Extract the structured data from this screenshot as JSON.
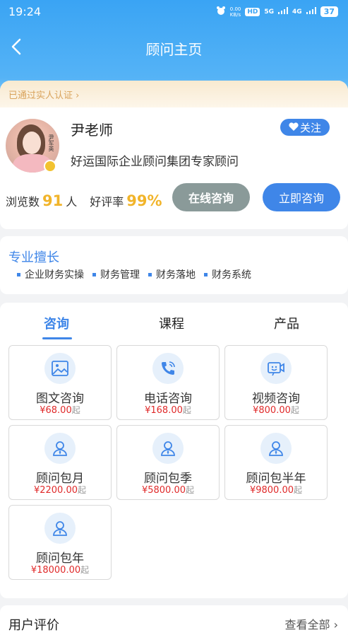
{
  "status_bar": {
    "time": "19:24",
    "net_speed": "0.00\nKB/s",
    "hd": "HD",
    "signal_5g": "5G",
    "signal_4g": "4G",
    "battery": "37"
  },
  "nav": {
    "title": "顾问主页"
  },
  "profile": {
    "verified_text": "已通过实人认证 ›",
    "name": "尹老师",
    "follow_label": "关注",
    "title": "好运国际企业顾问集团专家顾问",
    "views_label": "浏览数",
    "views_value": "91",
    "views_unit": "人",
    "rating_label": "好评率",
    "rating_value": "99%",
    "avatar_text": "尹军英",
    "btn_online": "在线咨询",
    "btn_now": "立即咨询"
  },
  "specialty": {
    "title": "专业擅长",
    "items": [
      "企业财务实操",
      "财务管理",
      "财务落地",
      "财务系统"
    ]
  },
  "tabs": [
    "咨询",
    "课程",
    "产品"
  ],
  "services": [
    {
      "label": "图文咨询",
      "price": "¥68.00",
      "suffix": "起",
      "icon": "image-icon"
    },
    {
      "label": "电话咨询",
      "price": "¥168.00",
      "suffix": "起",
      "icon": "phone-icon"
    },
    {
      "label": "视频咨询",
      "price": "¥800.00",
      "suffix": "起",
      "icon": "video-icon"
    },
    {
      "label": "顾问包月",
      "price": "¥2200.00",
      "suffix": "起",
      "icon": "consultant-icon"
    },
    {
      "label": "顾问包季",
      "price": "¥5800.00",
      "suffix": "起",
      "icon": "consultant-icon"
    },
    {
      "label": "顾问包半年",
      "price": "¥9800.00",
      "suffix": "起",
      "icon": "consultant-icon"
    },
    {
      "label": "顾问包年",
      "price": "¥18000.00",
      "suffix": "起",
      "icon": "consultant-icon"
    }
  ],
  "reviews": {
    "title": "用户评价",
    "view_all": "查看全部 ›"
  },
  "colors": {
    "primary": "#3f86e8",
    "header": "#3aa4f4",
    "accent": "#f1b42a",
    "price": "#e02a2a",
    "verified": "#d9a35c"
  }
}
